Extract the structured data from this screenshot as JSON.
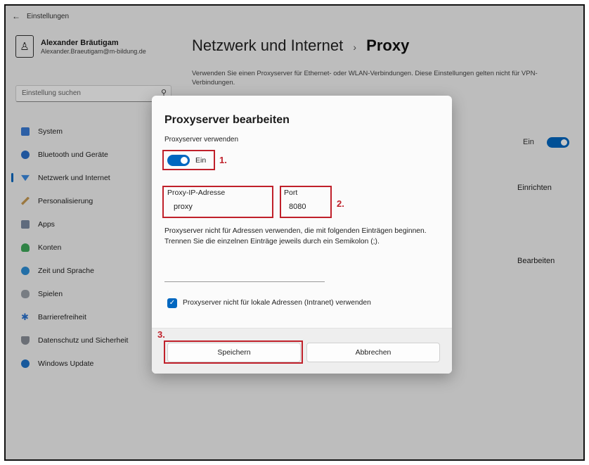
{
  "window": {
    "back_icon": "back-arrow-icon",
    "title": "Einstellungen"
  },
  "profile": {
    "name": "Alexander Bräutigam",
    "email": "Alexander.Braeutigam@m-bildung.de"
  },
  "search": {
    "placeholder": "Einstellung suchen"
  },
  "nav": {
    "items": [
      {
        "label": "System",
        "icon": "system-icon",
        "color": "#3a7bd5"
      },
      {
        "label": "Bluetooth und Geräte",
        "icon": "bluetooth-icon",
        "color": "#2a6fc9"
      },
      {
        "label": "Netzwerk und Internet",
        "icon": "network-icon",
        "color": "#3b8be0",
        "active": true
      },
      {
        "label": "Personalisierung",
        "icon": "brush-icon",
        "color": "#c79a52"
      },
      {
        "label": "Apps",
        "icon": "apps-icon",
        "color": "#7a8aa0"
      },
      {
        "label": "Konten",
        "icon": "accounts-icon",
        "color": "#3ea85a"
      },
      {
        "label": "Zeit und Sprache",
        "icon": "time-language-icon",
        "color": "#2d8fd6"
      },
      {
        "label": "Spielen",
        "icon": "gaming-icon",
        "color": "#9aa0a8"
      },
      {
        "label": "Barrierefreiheit",
        "icon": "accessibility-icon",
        "color": "#2a72d0"
      },
      {
        "label": "Datenschutz und Sicherheit",
        "icon": "shield-icon",
        "color": "#8a8f98"
      },
      {
        "label": "Windows Update",
        "icon": "update-icon",
        "color": "#1e73c8"
      }
    ]
  },
  "main": {
    "breadcrumb_parent": "Netzwerk und Internet",
    "breadcrumb_sep": "›",
    "breadcrumb_current": "Proxy",
    "description": "Verwenden Sie einen Proxyserver für Ethernet- oder WLAN-Verbindungen. Diese Einstellungen gelten nicht für VPN-Verbindungen.",
    "toggle_label": "Ein",
    "setup_button": "Einrichten",
    "edit_button": "Bearbeiten"
  },
  "dialog": {
    "title": "Proxyserver bearbeiten",
    "use_proxy_label": "Proxyserver verwenden",
    "toggle_state": "Ein",
    "ip_label": "Proxy-IP-Adresse",
    "ip_value": "proxy",
    "port_label": "Port",
    "port_value": "8080",
    "exceptions_text": "Proxyserver nicht für Adressen verwenden, die mit folgenden Einträgen beginnen. Trennen Sie die einzelnen Einträge jeweils durch ein Semikolon (;).",
    "exceptions_value": "",
    "local_checkbox_label": "Proxyserver nicht für lokale Adressen (Intranet) verwenden",
    "save_button": "Speichern",
    "cancel_button": "Abbrechen"
  },
  "annotations": {
    "step1": "1.",
    "step2": "2.",
    "step3": "3.",
    "color": "#c0202a"
  },
  "accent_color": "#0067c0"
}
